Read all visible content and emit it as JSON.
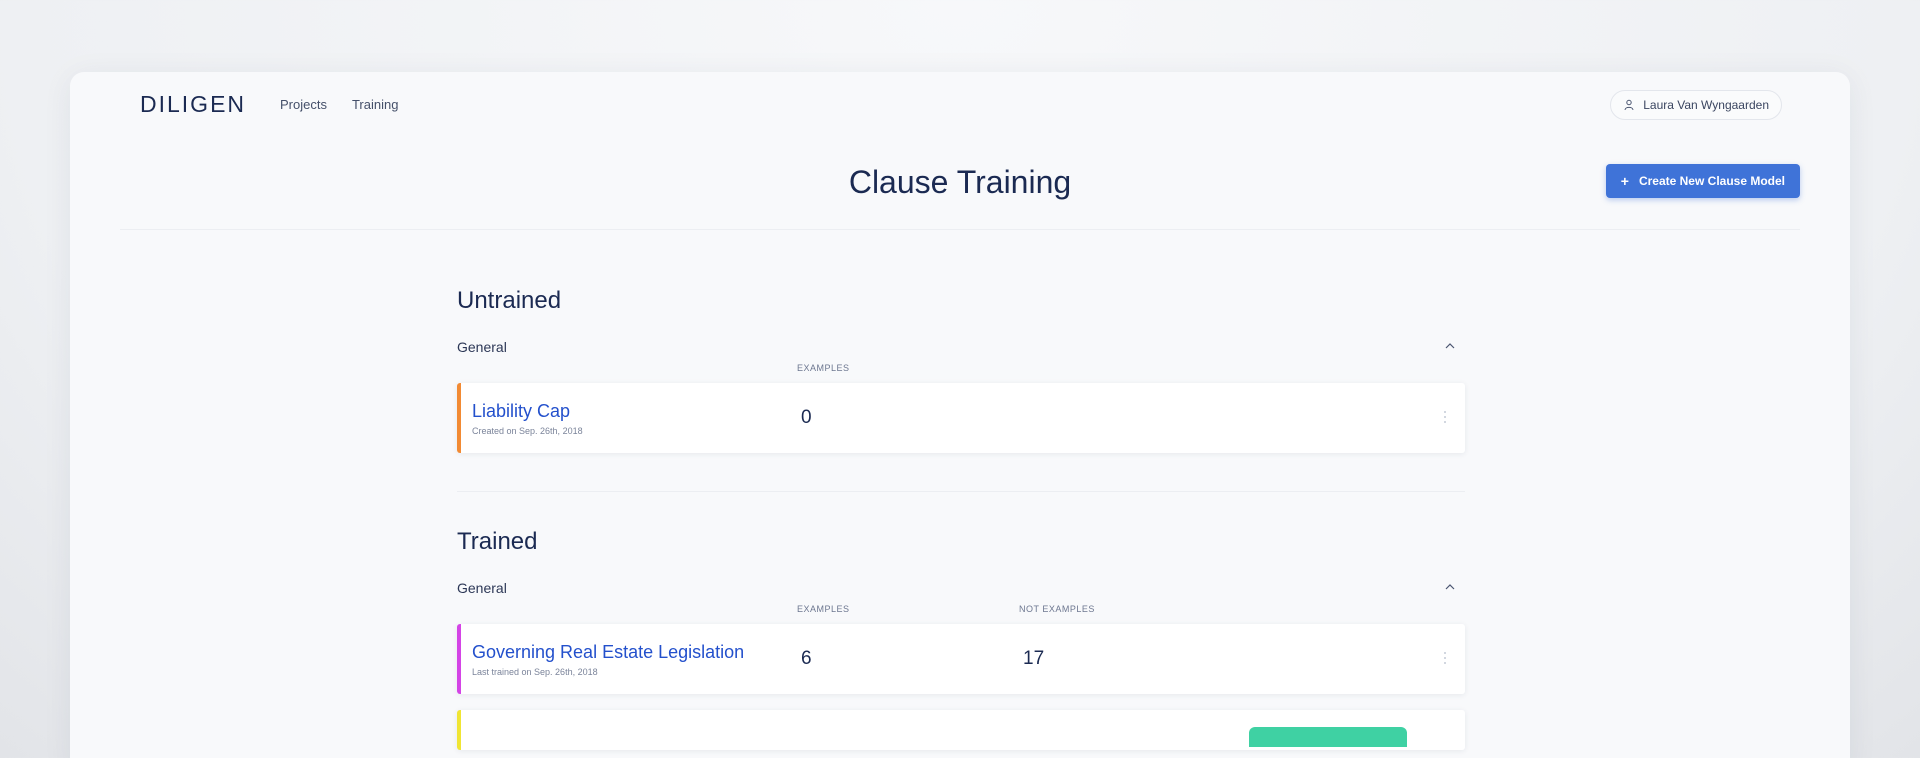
{
  "app": {
    "logo": "DILIGEN",
    "nav": [
      "Projects",
      "Training"
    ],
    "user_name": "Laura Van Wyngaarden"
  },
  "page": {
    "title": "Clause Training",
    "create_button_label": "Create New Clause Model"
  },
  "sections": {
    "untrained": {
      "title": "Untrained",
      "group": "General",
      "columns": [
        "EXAMPLES"
      ],
      "items": [
        {
          "name": "Liability Cap",
          "subtitle": "Created on Sep. 26th, 2018",
          "examples": "0",
          "accent": "#f28a33"
        }
      ]
    },
    "trained": {
      "title": "Trained",
      "group": "General",
      "columns": [
        "EXAMPLES",
        "NOT EXAMPLES"
      ],
      "items": [
        {
          "name": "Governing Real Estate Legislation",
          "subtitle": "Last trained on Sep. 26th, 2018",
          "examples": "6",
          "not_examples": "17",
          "accent": "#d444e6"
        }
      ]
    }
  },
  "colors": {
    "primary_button": "#3f73d8",
    "link": "#2350cc",
    "status_green": "#3fd1a3",
    "partial_accent": "#f0e534"
  }
}
